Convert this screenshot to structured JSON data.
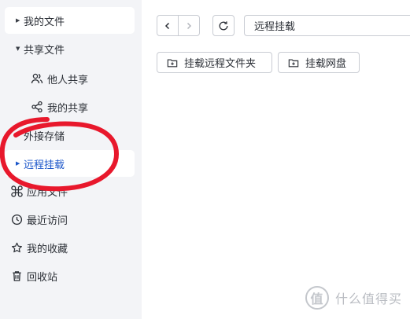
{
  "sidebar": {
    "items": [
      {
        "label": "我的文件"
      },
      {
        "label": "共享文件"
      },
      {
        "label": "他人共享"
      },
      {
        "label": "我的共享"
      },
      {
        "label": "外接存储"
      },
      {
        "label": "远程挂载"
      },
      {
        "label": "应用文件"
      },
      {
        "label": "最近访问"
      },
      {
        "label": "我的收藏"
      },
      {
        "label": "回收站"
      }
    ]
  },
  "toolbar": {
    "path": "远程挂载"
  },
  "actions": {
    "mount_folder_label": "挂载远程文件夹",
    "mount_disk_label": "挂载网盘"
  },
  "watermark": {
    "text": "什么值得买",
    "logo": "值"
  },
  "colors": {
    "sidebar_bg": "#f3f4f7",
    "active_text": "#1a55c9",
    "annotation": "#e8182c"
  },
  "icons": {
    "collapsed": "caret-right-icon",
    "expanded": "caret-down-icon"
  }
}
